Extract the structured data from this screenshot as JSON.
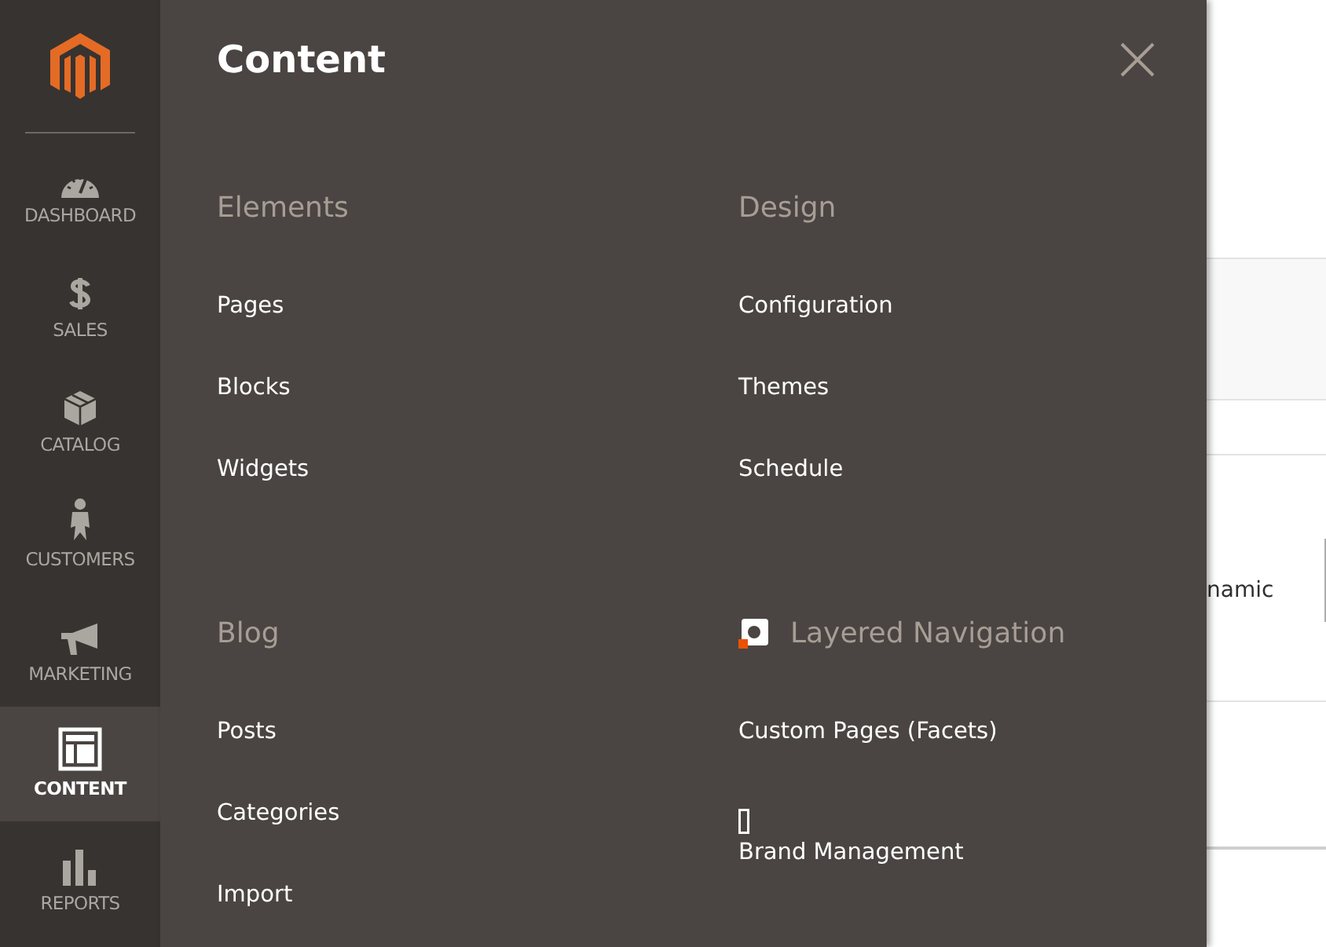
{
  "sidebar": {
    "items": [
      {
        "label": "DASHBOARD",
        "selected": false
      },
      {
        "label": "SALES",
        "selected": false
      },
      {
        "label": "CATALOG",
        "selected": false
      },
      {
        "label": "CUSTOMERS",
        "selected": false
      },
      {
        "label": "MARKETING",
        "selected": false
      },
      {
        "label": "CONTENT",
        "selected": true
      },
      {
        "label": "REPORTS",
        "selected": false
      }
    ]
  },
  "panel": {
    "title": "Content",
    "columns": [
      {
        "groups": [
          {
            "heading": "Elements",
            "kind": "plain",
            "items": [
              {
                "label": "Pages",
                "kind": "plain"
              },
              {
                "label": "Blocks",
                "kind": "plain"
              },
              {
                "label": "Widgets",
                "kind": "plain"
              }
            ]
          },
          {
            "heading": "Blog",
            "kind": "plain",
            "items": [
              {
                "label": "Posts",
                "kind": "plain"
              },
              {
                "label": "Categories",
                "kind": "plain"
              },
              {
                "label": "Import",
                "kind": "plain"
              }
            ]
          }
        ]
      },
      {
        "groups": [
          {
            "heading": "Design",
            "kind": "plain",
            "items": [
              {
                "label": "Configuration",
                "kind": "plain"
              },
              {
                "label": "Themes",
                "kind": "plain"
              },
              {
                "label": "Schedule",
                "kind": "plain"
              }
            ]
          },
          {
            "heading": "Layered Navigation",
            "kind": "branded",
            "items": [
              {
                "label": "Custom Pages (Facets)",
                "kind": "plain"
              },
              {
                "label": "Brand Management",
                "kind": "glyph"
              }
            ]
          }
        ]
      }
    ]
  },
  "background": {
    "fragment": "namic"
  }
}
